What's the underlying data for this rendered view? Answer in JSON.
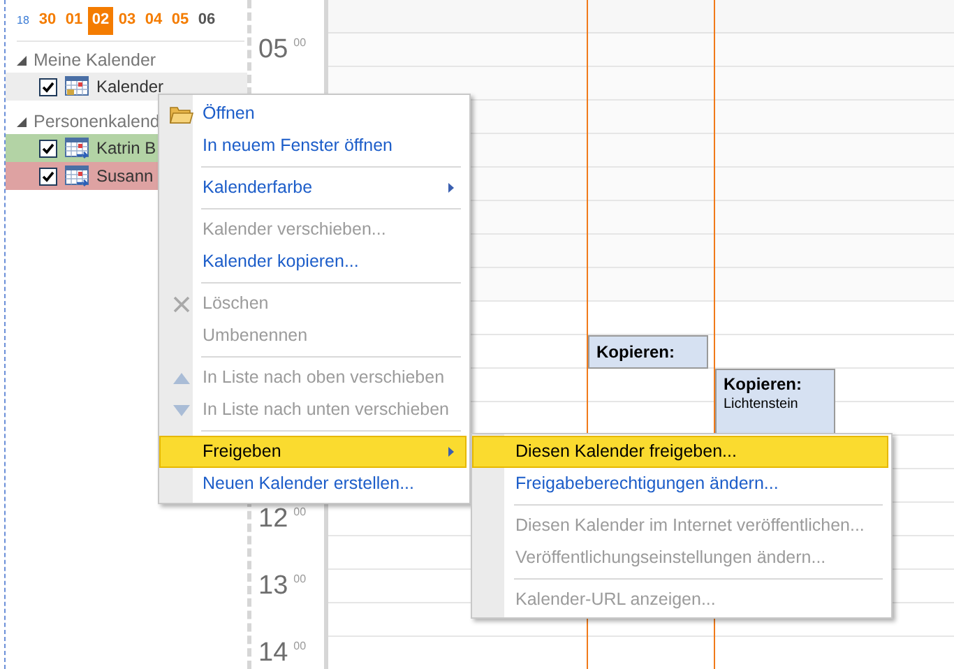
{
  "mini_calendar": {
    "week": "18",
    "days": [
      {
        "label": "30",
        "selected": false,
        "muted": false
      },
      {
        "label": "01",
        "selected": false,
        "muted": false
      },
      {
        "label": "02",
        "selected": true,
        "muted": false
      },
      {
        "label": "03",
        "selected": false,
        "muted": false
      },
      {
        "label": "04",
        "selected": false,
        "muted": false
      },
      {
        "label": "05",
        "selected": false,
        "muted": false
      },
      {
        "label": "06",
        "selected": false,
        "muted": true
      }
    ]
  },
  "calendar_groups": [
    {
      "title": "Meine Kalender",
      "expanded": true,
      "items": [
        {
          "label": "Kalender",
          "checked": true,
          "selected": true
        }
      ]
    },
    {
      "title": "Personenkalend",
      "expanded": true,
      "items": [
        {
          "label": "Katrin B",
          "checked": true,
          "selected": false,
          "color": "#b3d3a5"
        },
        {
          "label": "Susann",
          "checked": true,
          "selected": false,
          "color": "#dea2a2"
        }
      ]
    }
  ],
  "time_ruler": [
    {
      "hour": "05",
      "minutes": "00"
    },
    {
      "hour": "12",
      "minutes": "00"
    },
    {
      "hour": "13",
      "minutes": "00"
    },
    {
      "hour": "14",
      "minutes": "00"
    }
  ],
  "appointments": [
    {
      "title": "Kopieren:"
    },
    {
      "title": "Kopieren:",
      "location": "Lichtenstein"
    }
  ],
  "context_menu": {
    "items": [
      {
        "kind": "item",
        "label": "Öffnen",
        "disabled": false,
        "submenu": false,
        "selected": false
      },
      {
        "kind": "item",
        "label": "In neuem Fenster öffnen",
        "disabled": false,
        "submenu": false,
        "selected": false
      },
      {
        "kind": "separator"
      },
      {
        "kind": "item",
        "label": "Kalenderfarbe",
        "disabled": false,
        "submenu": true,
        "selected": false
      },
      {
        "kind": "separator"
      },
      {
        "kind": "item",
        "label": "Kalender verschieben...",
        "disabled": true,
        "submenu": false,
        "selected": false
      },
      {
        "kind": "item",
        "label": "Kalender kopieren...",
        "disabled": false,
        "submenu": false,
        "selected": false
      },
      {
        "kind": "separator"
      },
      {
        "kind": "item",
        "label": "Löschen",
        "disabled": true,
        "submenu": false,
        "selected": false
      },
      {
        "kind": "item",
        "label": "Umbenennen",
        "disabled": true,
        "submenu": false,
        "selected": false
      },
      {
        "kind": "separator"
      },
      {
        "kind": "item",
        "label": "In Liste nach oben verschieben",
        "disabled": true,
        "submenu": false,
        "selected": false
      },
      {
        "kind": "item",
        "label": "In Liste nach unten verschieben",
        "disabled": true,
        "submenu": false,
        "selected": false
      },
      {
        "kind": "separator"
      },
      {
        "kind": "item",
        "label": "Freigeben",
        "disabled": false,
        "submenu": true,
        "selected": true
      },
      {
        "kind": "item",
        "label": "Neuen Kalender erstellen...",
        "disabled": false,
        "submenu": false,
        "selected": false
      }
    ]
  },
  "submenu": {
    "items": [
      {
        "kind": "item",
        "label": "Diesen Kalender freigeben...",
        "disabled": false,
        "selected": true
      },
      {
        "kind": "item",
        "label": "Freigabeberechtigungen ändern...",
        "disabled": false,
        "selected": false
      },
      {
        "kind": "separator"
      },
      {
        "kind": "item",
        "label": "Diesen Kalender im Internet veröffentlichen...",
        "disabled": true,
        "selected": false
      },
      {
        "kind": "item",
        "label": "Veröffentlichungseinstellungen ändern...",
        "disabled": true,
        "selected": false
      },
      {
        "kind": "separator"
      },
      {
        "kind": "item",
        "label": "Kalender-URL anzeigen...",
        "disabled": true,
        "selected": false
      }
    ]
  }
}
